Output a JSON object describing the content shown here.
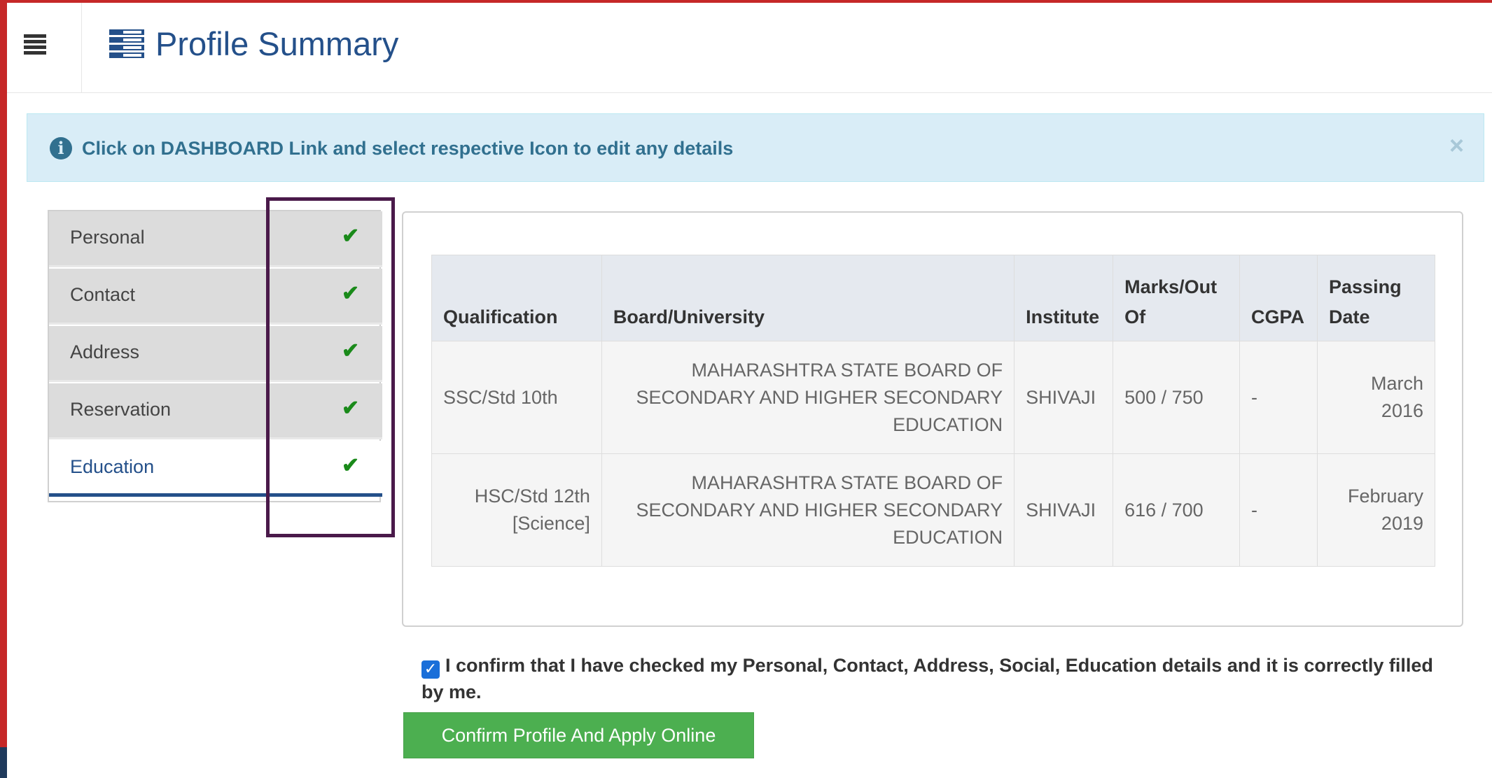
{
  "header": {
    "title": "Profile Summary"
  },
  "alert": {
    "text": "Click on DASHBOARD Link and select respective Icon to edit any details",
    "close": "×"
  },
  "tabs": [
    {
      "label": "Personal",
      "check": "✔"
    },
    {
      "label": "Contact",
      "check": "✔"
    },
    {
      "label": "Address",
      "check": "✔"
    },
    {
      "label": "Reservation",
      "check": "✔"
    },
    {
      "label": "Education",
      "check": "✔"
    }
  ],
  "table": {
    "headers": {
      "qualification": "Qualification",
      "board": "Board/University",
      "institute": "Institute",
      "marks": "Marks/Out Of",
      "cgpa": "CGPA",
      "passing": "Passing Date"
    },
    "rows": [
      {
        "qualification": "SSC/Std 10th",
        "board": "MAHARASHTRA STATE BOARD OF SECONDARY AND HIGHER SECONDARY EDUCATION",
        "institute": "SHIVAJI",
        "marks": "500 / 750",
        "cgpa": "-",
        "passing": "March 2016"
      },
      {
        "qualification": "HSC/Std 12th [Science]",
        "board": "MAHARASHTRA STATE BOARD OF SECONDARY AND HIGHER SECONDARY EDUCATION",
        "institute": "SHIVAJI",
        "marks": "616 / 700",
        "cgpa": "-",
        "passing": "February 2019"
      }
    ]
  },
  "confirm": {
    "checked": true,
    "checkmark": "✓",
    "text": "I confirm that I have checked my Personal, Contact, Address, Social, Education details and it is correctly filled by me."
  },
  "button": {
    "label": "Confirm Profile And Apply Online"
  },
  "colors": {
    "primary": "#24508a",
    "alert_bg": "#d9edf7",
    "success": "#4caf50",
    "check": "#1a8a1a",
    "frame": "#c62828"
  }
}
